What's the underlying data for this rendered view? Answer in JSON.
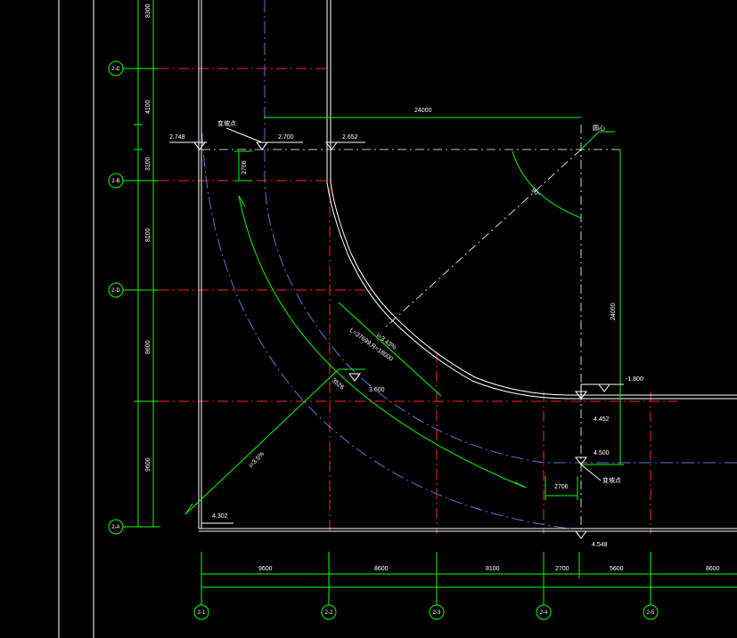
{
  "axes_left": [
    "2-C",
    "2-B",
    "2-D",
    "2-A"
  ],
  "axes_bottom": [
    "2-1",
    "2-2",
    "2-3",
    "2-4",
    "2-5"
  ],
  "dims_bottom": [
    "9600",
    "8600",
    "8100",
    "2700",
    "5600",
    "8600"
  ],
  "dims_left": [
    "8300",
    "4100",
    "3100",
    "8100",
    "8600",
    "9600"
  ],
  "elevations": {
    "e1": "2.748",
    "e2": "2.700",
    "e3": "2.652",
    "e4": "3.600",
    "e5": "-1.800",
    "e6": "4.452",
    "e7": "4.500",
    "e8": "4.548",
    "e9": "4.302"
  },
  "labels": {
    "change_point_top": "变坡点",
    "change_point_right": "变坡点",
    "center": "圆心",
    "angle": "90°",
    "top_radius_dim": "24000",
    "right_radius_dim": "24000",
    "slope_main": "i=3.43%",
    "slope_formula": "L=37699,R=18000",
    "slope_diag": "i=3.5%",
    "dim_2706_top": "2706",
    "dim_3526": "3526",
    "dim_2706_right": "2706"
  },
  "colors": {
    "background": "#000000",
    "grid_axis": "#ff2020",
    "dimension": "#00ff00",
    "outline": "#ffffff",
    "ramp_centerline": "#6a6ad8"
  }
}
